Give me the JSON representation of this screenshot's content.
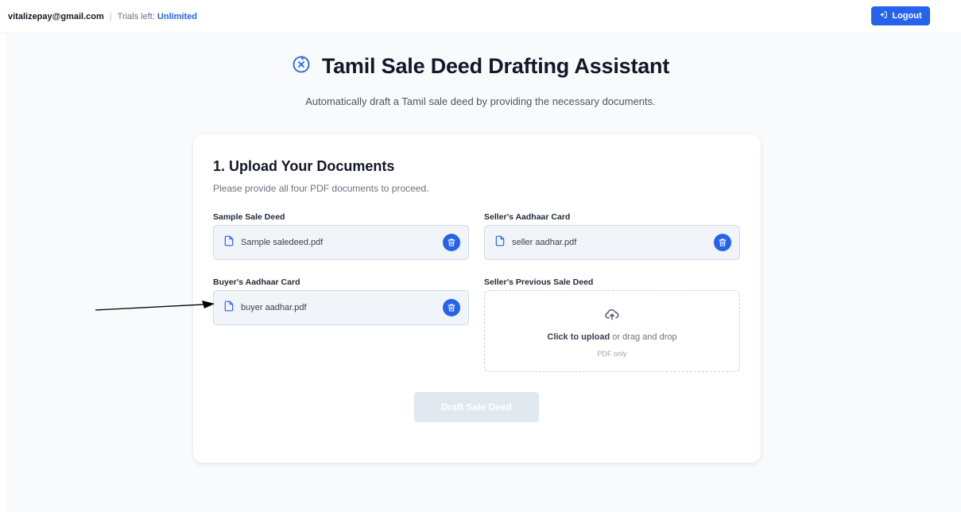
{
  "header": {
    "email": "vitalizepay@gmail.com",
    "separator": "|",
    "trials_label": "Trials left:",
    "trials_value": "Unlimited",
    "logout_label": "Logout",
    "logout_icon": "logout-icon"
  },
  "hero": {
    "icon": "compass-x-icon",
    "title": "Tamil Sale Deed Drafting Assistant",
    "subtitle": "Automatically draft a Tamil sale deed by providing the necessary documents."
  },
  "upload": {
    "heading": "1. Upload Your Documents",
    "description": "Please provide all four PDF documents to proceed.",
    "fields": [
      {
        "label": "Sample Sale Deed",
        "file_name": "Sample saledeed.pdf"
      },
      {
        "label": "Seller's Aadhaar Card",
        "file_name": "seller aadhar.pdf"
      },
      {
        "label": "Buyer's Aadhaar Card",
        "file_name": "buyer aadhar.pdf"
      },
      {
        "label": "Seller's Previous Sale Deed",
        "file_name": ""
      }
    ],
    "dropzone": {
      "click_text": "Click to upload",
      "drag_text": "or drag and drop",
      "hint": "PDF only",
      "icon": "cloud-upload-icon"
    }
  },
  "actions": {
    "draft_label": "Draft Sale Deed",
    "draft_enabled": false
  },
  "colors": {
    "accent": "#2563eb",
    "disabled": "#e2e8f0",
    "text_dark": "#111827"
  }
}
